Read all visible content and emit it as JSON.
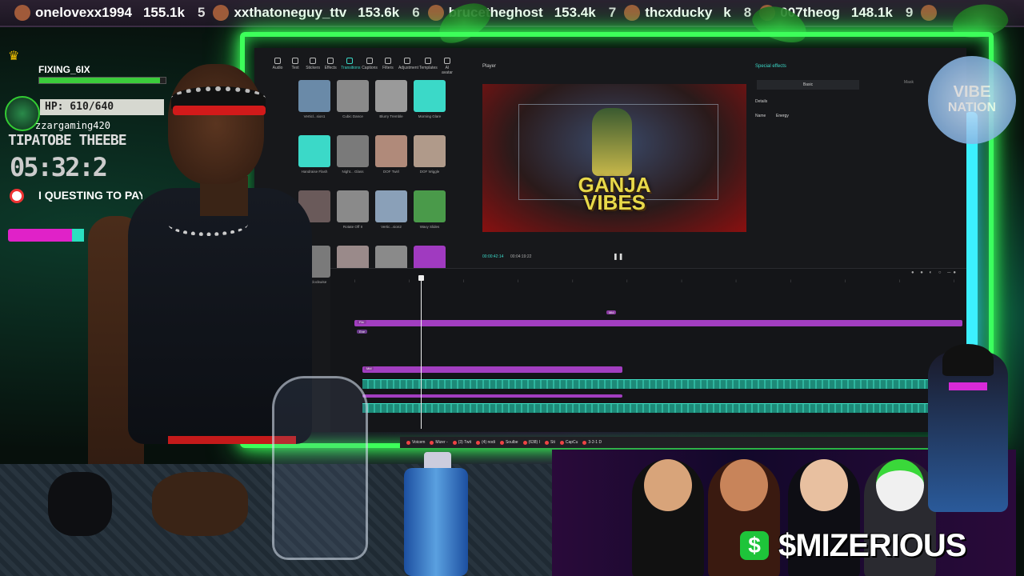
{
  "ticker": [
    {
      "rank": "",
      "name": "onelovexx1994",
      "amount": "155.1k"
    },
    {
      "rank": "5",
      "name": "xxthatoneguy_ttv",
      "amount": "153.6k"
    },
    {
      "rank": "6",
      "name": "brucetheghost",
      "amount": "153.4k"
    },
    {
      "rank": "7",
      "name": "thcxducky",
      "amount": "k"
    },
    {
      "rank": "8",
      "name": "007theog",
      "amount": "148.1k"
    },
    {
      "rank": "9",
      "name": "",
      "amount": ""
    }
  ],
  "hud": {
    "player_name": "FIXING_6IX",
    "hp_text": "HP: 610/640",
    "hp_fraction": 0.953,
    "username": "zzargaming420",
    "headline": "TIPATOBE THEEBE",
    "timer": "05:32:2",
    "quest": "I QUESTING TO PAY B"
  },
  "editor": {
    "toolbar": [
      {
        "label": "Audio"
      },
      {
        "label": "Text"
      },
      {
        "label": "Stickers"
      },
      {
        "label": "Effects"
      },
      {
        "label": "Transitions",
        "active": true
      },
      {
        "label": "Captions"
      },
      {
        "label": "Filters"
      },
      {
        "label": "Adjustment"
      },
      {
        "label": "Templates"
      },
      {
        "label": "AI avatar"
      }
    ],
    "media": [
      {
        "label": "Verticl...sion1",
        "color": "#6a8aa8"
      },
      {
        "label": "Cubic Dance",
        "color": "#8a8a8a"
      },
      {
        "label": "Blurry Tremble",
        "color": "#9a9a9a"
      },
      {
        "label": "Morning Glare",
        "color": "#3bd9c8"
      },
      {
        "label": "Handraise Flash",
        "color": "#3bd9c8"
      },
      {
        "label": "Night... Glass",
        "color": "#7a7a7a"
      },
      {
        "label": "DOF Twirl",
        "color": "#b08a7a"
      },
      {
        "label": "DOF Wiggle",
        "color": "#b09a8a"
      },
      {
        "label": "",
        "color": "#6a5a5a"
      },
      {
        "label": "Rotate Off II",
        "color": "#8a8a8a"
      },
      {
        "label": "Vertic...sion2",
        "color": "#8aa0b8"
      },
      {
        "label": "Wavy Slides",
        "color": "#4a9a4a"
      },
      {
        "label": "Spin Clockwise",
        "color": "#7a7a7a"
      },
      {
        "label": "Shake 3",
        "color": "#9a8a8a"
      },
      {
        "label": "",
        "color": "#8a8a8a"
      },
      {
        "label": "Rainbow Filter",
        "color": "#a03ac0"
      }
    ],
    "player_label": "Player",
    "preview_title_line1": "GANJA",
    "preview_title_line2": "VIBES",
    "timecode_current": "00:00:42:14",
    "timecode_total": "00:04:19:22",
    "side_title": "Special effects",
    "side_tab_basic": "Basic",
    "side_tab_mask": "Mask",
    "details_label": "Details",
    "name_label": "Name",
    "name_value": "Energy",
    "clip_label_mid": "Mid",
    "clip_label_top": "Fla",
    "clip_label_sub": "Ene",
    "clip_label_lower": "Mid"
  },
  "taskbar": [
    {
      "label": "Voicem"
    },
    {
      "label": "Mizer -"
    },
    {
      "label": "(3) Twit"
    },
    {
      "label": "(4) nodi"
    },
    {
      "label": "Soulbe"
    },
    {
      "label": "(638) I"
    },
    {
      "label": "Sti"
    },
    {
      "label": "CapCu"
    },
    {
      "label": "3-2-1 D"
    }
  ],
  "right": {
    "logo_line1": "VIBE",
    "logo_line2": "NATION"
  },
  "sponsor": {
    "cash_symbol": "$",
    "cashtag": "$MIZERIOUS"
  },
  "colors": {
    "neon_green": "#3dff5a",
    "neon_cyan": "#3cf0ff",
    "clip_purple": "#a23ec0",
    "wave_teal": "#2fb59e",
    "cash_green": "#1ec43a"
  }
}
